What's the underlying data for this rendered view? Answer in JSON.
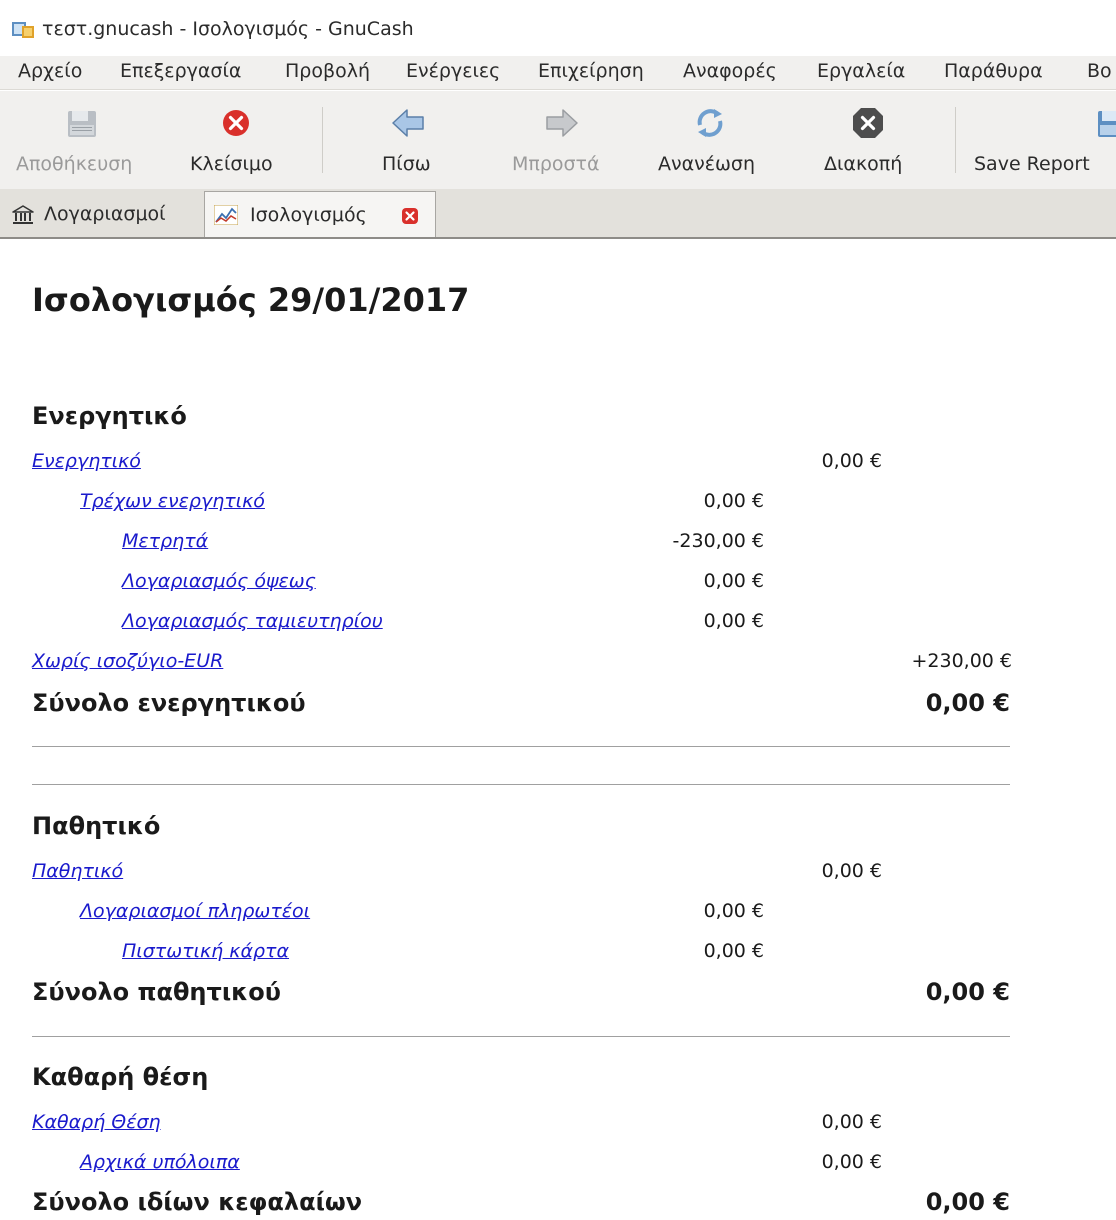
{
  "window": {
    "title": "τεστ.gnucash - Ισολογισμός - GnuCash"
  },
  "menubar": {
    "items": [
      {
        "label": "Αρχείο"
      },
      {
        "label": "Επεξεργασία"
      },
      {
        "label": "Προβολή"
      },
      {
        "label": "Ενέργειες"
      },
      {
        "label": "Επιχείρηση"
      },
      {
        "label": "Αναφορές"
      },
      {
        "label": "Εργαλεία"
      },
      {
        "label": "Παράθυρα"
      },
      {
        "label": "Βο"
      }
    ]
  },
  "toolbar": {
    "save": {
      "label": "Αποθήκευση",
      "icon": "save-icon",
      "enabled": false
    },
    "close": {
      "label": "Κλείσιμο",
      "icon": "close-icon",
      "enabled": true
    },
    "back": {
      "label": "Πίσω",
      "icon": "back-arrow-icon",
      "enabled": true
    },
    "forward": {
      "label": "Μπροστά",
      "icon": "forward-arrow-icon",
      "enabled": false
    },
    "reload": {
      "label": "Ανανέωση",
      "icon": "reload-icon",
      "enabled": true
    },
    "stop": {
      "label": "Διακοπή",
      "icon": "stop-icon",
      "enabled": true
    },
    "save_report": {
      "label": "Save Report",
      "icon": "save-report-icon",
      "enabled": true
    }
  },
  "tabs": [
    {
      "label": "Λογαριασμοί",
      "icon": "bank-icon",
      "active": false
    },
    {
      "label": "Ισολογισμός",
      "icon": "chart-icon",
      "active": true,
      "closable": true
    }
  ],
  "report": {
    "title": "Ισολογισμός 29/01/2017",
    "assets": {
      "heading": "Ενεργητικό",
      "rows": [
        {
          "name": "Ενεργητικό",
          "amount": "0,00 €"
        },
        {
          "name": "Τρέχων ενεργητικό",
          "amount": "0,00 €"
        },
        {
          "name": "Μετρητά",
          "amount": "-230,00 €"
        },
        {
          "name": "Λογαριασμός όψεως",
          "amount": "0,00 €"
        },
        {
          "name": "Λογαριασμός ταμιευτηρίου",
          "amount": "0,00 €"
        },
        {
          "name": "Χωρίς ισοζύγιο-EUR",
          "amount": "+230,00 €"
        }
      ],
      "total_label": "Σύνολο ενεργητικού",
      "total_amount": "0,00 €"
    },
    "liabilities": {
      "heading": "Παθητικό",
      "rows": [
        {
          "name": "Παθητικό",
          "amount": "0,00 €"
        },
        {
          "name": "Λογαριασμοί πληρωτέοι",
          "amount": "0,00 €"
        },
        {
          "name": "Πιστωτική κάρτα",
          "amount": "0,00 €"
        }
      ],
      "total_label": "Σύνολο παθητικού",
      "total_amount": "0,00 €"
    },
    "equity": {
      "heading": "Καθαρή θέση",
      "rows": [
        {
          "name": "Καθαρή Θέση",
          "amount": "0,00 €"
        },
        {
          "name": "Αρχικά υπόλοιπα",
          "amount": "0,00 €"
        }
      ],
      "total_label": "Σύνολο ιδίων κεφαλαίων",
      "total_amount": "0,00 €"
    }
  },
  "colors": {
    "link": "#1a1acc",
    "chrome": "#f1f0ee",
    "close_red": "#d9302b"
  }
}
